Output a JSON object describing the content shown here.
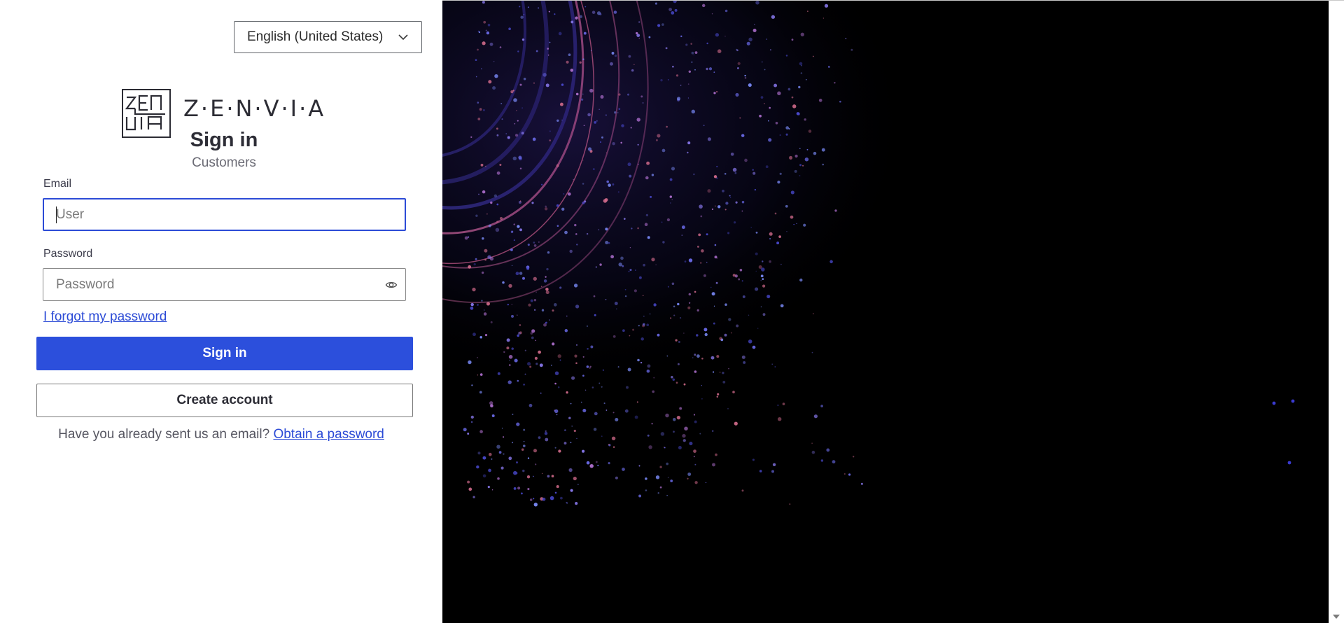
{
  "language_selector": {
    "value": "English (United States)"
  },
  "logo": {
    "wordmark": "Z·E·N·V·I·A",
    "mark_text": [
      "ZEN",
      "VIA"
    ]
  },
  "header": {
    "title": "Sign in",
    "subtitle": "Customers"
  },
  "form": {
    "email_label": "Email",
    "email_placeholder": "User",
    "email_value": "",
    "password_label": "Password",
    "password_placeholder": "Password",
    "password_value": "",
    "forgot_link": "I forgot my password",
    "signin_button": "Sign in",
    "create_account_button": "Create account"
  },
  "footer": {
    "question": "Have you already sent us an email? ",
    "obtain_link": "Obtain a password"
  },
  "colors": {
    "primary": "#2c4fdc",
    "link": "#2c4bd6",
    "background_right": "#000000"
  },
  "icons": {
    "language_dropdown": "chevron-down-icon",
    "password_toggle": "eye-icon",
    "scroll_down": "scroll-down-arrow"
  }
}
